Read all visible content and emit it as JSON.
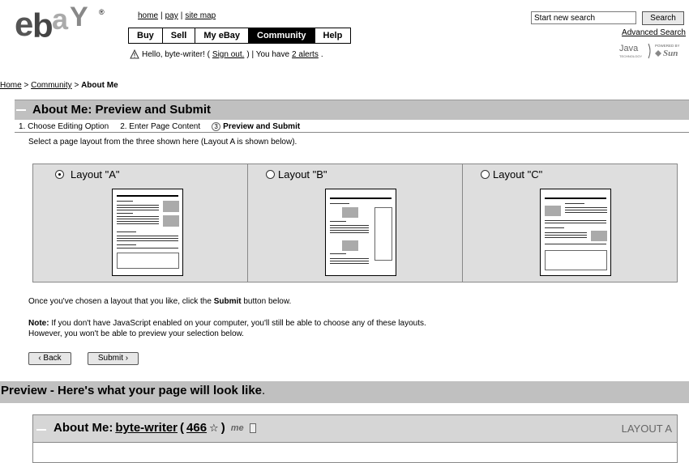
{
  "header": {
    "logo_text": "ebaY",
    "top_links": [
      "home",
      "pay",
      "site map"
    ],
    "tabs": [
      "Buy",
      "Sell",
      "My eBay",
      "Community",
      "Help"
    ],
    "active_tab": "Community",
    "greeting_prefix": "Hello, byte-writer! (",
    "sign_out": "Sign out.",
    "greeting_mid": ") | You have ",
    "alerts_link": "2 alerts",
    "greeting_end": ".",
    "search_value": "Start new search",
    "search_button": "Search",
    "advanced_search": "Advanced Search",
    "java_text": "Java",
    "java_sub": "TECHNOLOGY",
    "powered_text": "POWERED BY",
    "sun_text": "Sun"
  },
  "breadcrumb": {
    "home": "Home",
    "sep1": " > ",
    "community": "Community",
    "sep2": " > ",
    "current": "About Me"
  },
  "page": {
    "title": "About Me: Preview and Submit",
    "steps": [
      "1. Choose Editing Option",
      "2. Enter Page Content"
    ],
    "current_step_num": "3",
    "current_step_label": "Preview and Submit",
    "intro": "Select a page layout from the three shown here (Layout A is shown below).",
    "layouts": [
      {
        "label": "Layout \"A\"",
        "selected": true
      },
      {
        "label": "Layout \"B\"",
        "selected": false
      },
      {
        "label": "Layout \"C\"",
        "selected": false
      }
    ],
    "chosen_prefix": "Once you've chosen a layout that you like, click the ",
    "chosen_bold": "Submit",
    "chosen_suffix": " button below.",
    "note_label": "Note:",
    "note_line1": " If you don't have JavaScript enabled on your computer, you'll still be able to choose any of these layouts.",
    "note_line2": "However, you won't be able to preview your selection below.",
    "back_button": "‹ Back",
    "submit_button": "Submit ›"
  },
  "preview": {
    "heading": "Preview - Here's what your page will look like",
    "heading_dot": ".",
    "box_title": "About Me: ",
    "user": "byte-writer",
    "paren_open": " ( ",
    "score": "466",
    "paren_close": " )",
    "star": "☆",
    "me_icon": "me",
    "layout_tag": "LAYOUT A"
  },
  "icons": {
    "alert": "warning-triangle-icon",
    "star": "star-icon",
    "me": "me-badge-icon",
    "page": "page-icon"
  }
}
